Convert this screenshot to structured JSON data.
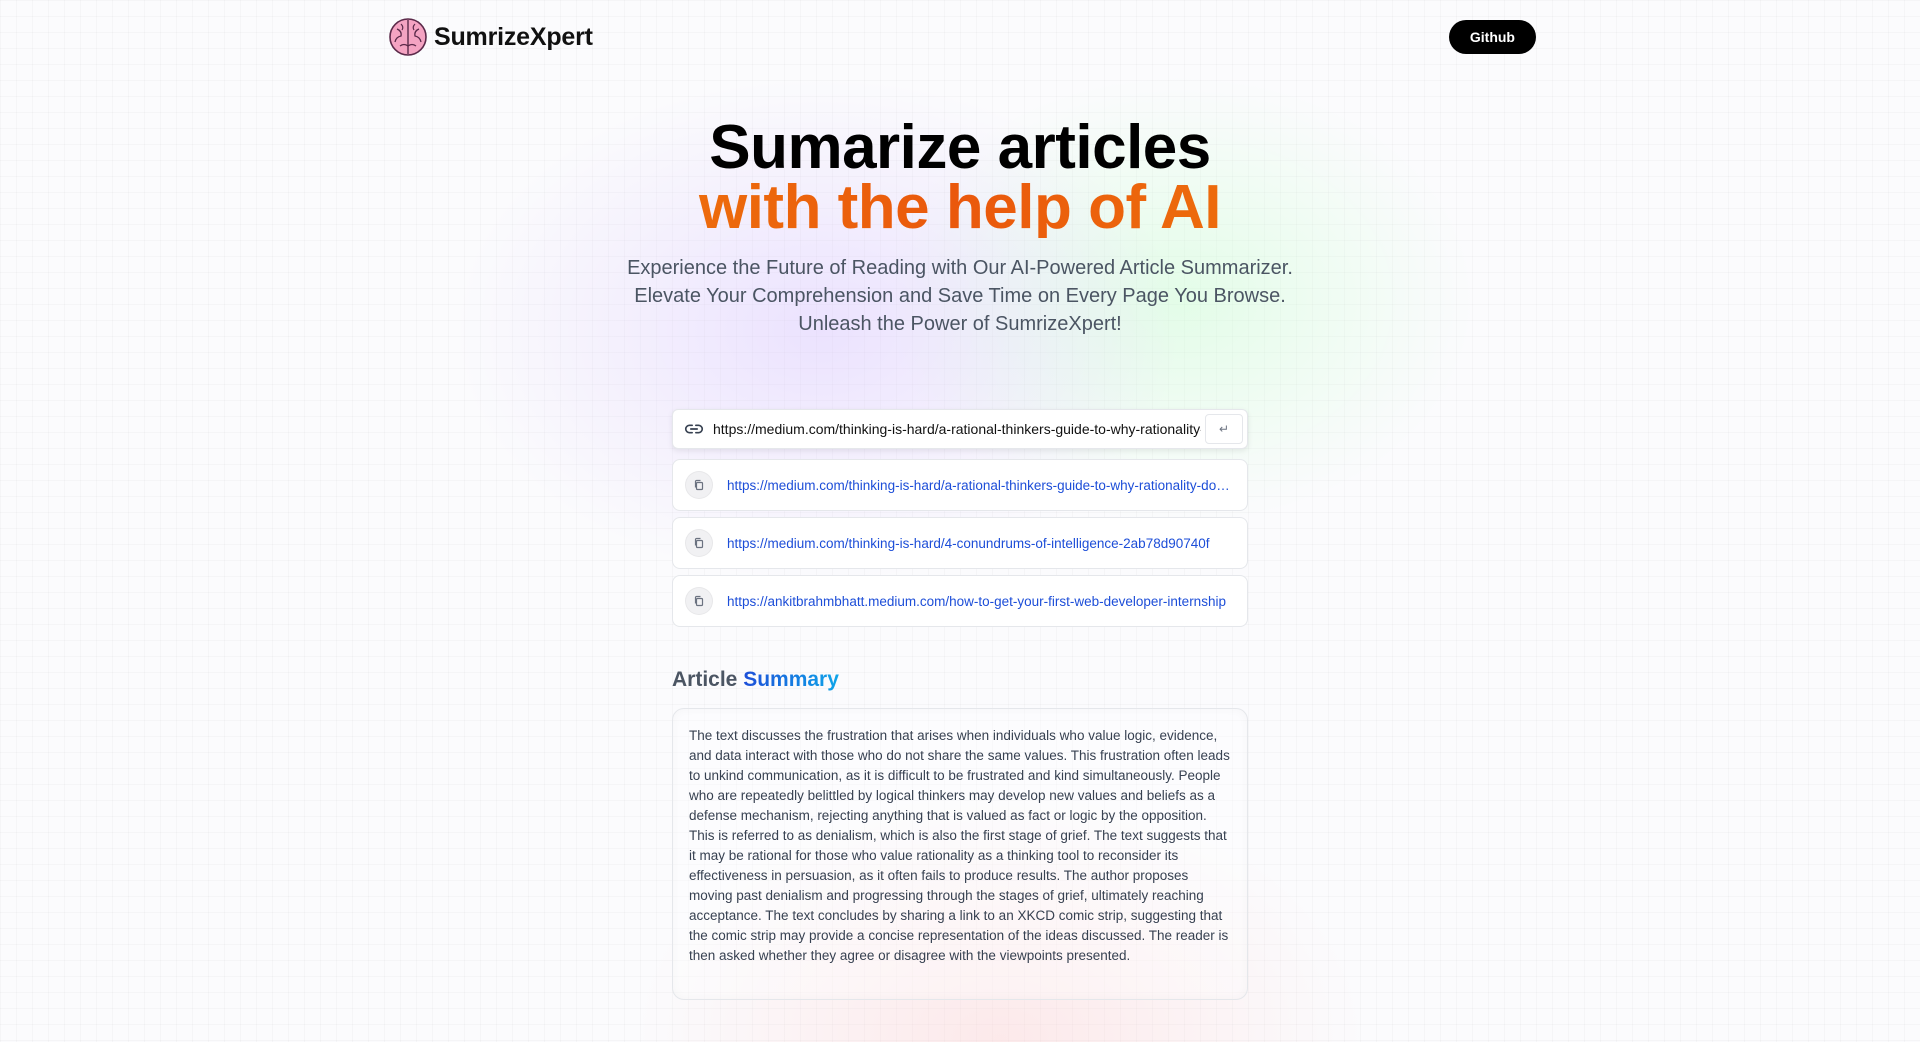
{
  "header": {
    "brand_name": "SumrizeXpert",
    "github_label": "Github"
  },
  "hero": {
    "title_line1": "Sumarize articles",
    "title_line2": "with the help of AI",
    "description": [
      "Experience the Future of Reading with Our AI-Powered Article Summarizer.",
      "Elevate Your Comprehension and Save Time on Every Page You Browse.",
      "Unleash the Power of SumrizeXpert!"
    ]
  },
  "search": {
    "value": "https://medium.com/thinking-is-hard/a-rational-thinkers-guide-to-why-rationality-doesnt-work",
    "submit_label": "↵"
  },
  "history": [
    {
      "url": "https://medium.com/thinking-is-hard/a-rational-thinkers-guide-to-why-rationality-doesnt-work"
    },
    {
      "url": "https://medium.com/thinking-is-hard/4-conundrums-of-intelligence-2ab78d90740f"
    },
    {
      "url": "https://ankitbrahmbhatt.medium.com/how-to-get-your-first-web-developer-internship"
    }
  ],
  "summary": {
    "title_prefix": "Article",
    "title_accent": "Summary",
    "text": "The text discusses the frustration that arises when individuals who value logic, evidence, and data interact with those who do not share the same values. This frustration often leads to unkind communication, as it is difficult to be frustrated and kind simultaneously. People who are repeatedly belittled by logical thinkers may develop new values and beliefs as a defense mechanism, rejecting anything that is valued as fact or logic by the opposition. This is referred to as denialism, which is also the first stage of grief. The text suggests that it may be rational for those who value rationality as a thinking tool to reconsider its effectiveness in persuasion, as it often fails to produce results. The author proposes moving past denialism and progressing through the stages of grief, ultimately reaching acceptance. The text concludes by sharing a link to an XKCD comic strip, suggesting that the comic strip may provide a concise representation of the ideas discussed. The reader is then asked whether they agree or disagree with the viewpoints presented."
  },
  "icons": {
    "logo": "brain-icon",
    "search": "link-icon",
    "submit": "enter-icon",
    "copy": "copy-icon"
  },
  "colors": {
    "title_gradient": [
      "#f59e0b",
      "#ea580c"
    ],
    "summary_accent": [
      "#1d4ed8",
      "#0ea5e9"
    ],
    "link": "#1d4ed8",
    "button_bg": "#000000"
  }
}
